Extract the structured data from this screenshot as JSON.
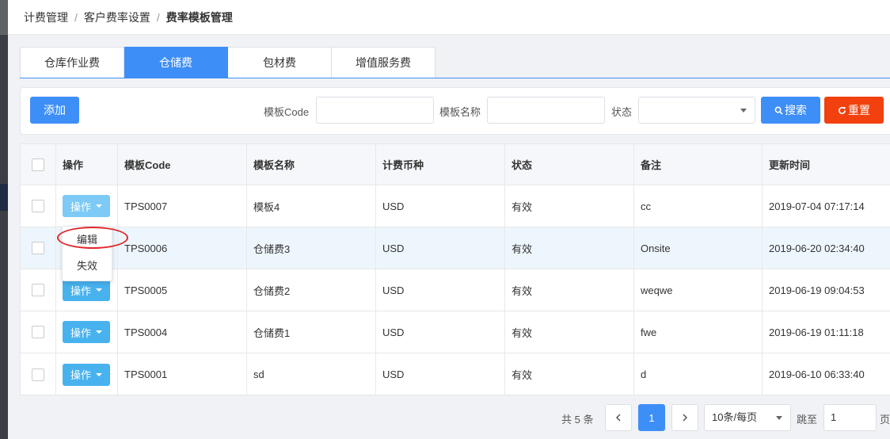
{
  "breadcrumb": {
    "item1": "计费管理",
    "item2": "客户费率设置",
    "current": "费率模板管理"
  },
  "tabs": [
    {
      "label": "仓库作业费",
      "active": false
    },
    {
      "label": "仓储费",
      "active": true
    },
    {
      "label": "包材费",
      "active": false
    },
    {
      "label": "增值服务费",
      "active": false
    }
  ],
  "filter": {
    "add_label": "添加",
    "code_label": "模板Code",
    "code_value": "",
    "name_label": "模板名称",
    "name_value": "",
    "status_label": "状态",
    "status_value": "",
    "search_label": "搜索",
    "reset_label": "重置"
  },
  "table": {
    "headers": [
      "操作",
      "模板Code",
      "模板名称",
      "计费币种",
      "状态",
      "备注",
      "更新时间"
    ],
    "op_label": "操作",
    "rows": [
      {
        "code": "TPS0007",
        "name": "模板4",
        "currency": "USD",
        "status": "有效",
        "remark": "cc",
        "updated": "2019-07-04 07:17:14"
      },
      {
        "code": "TPS0006",
        "name": "仓储费3",
        "currency": "USD",
        "status": "有效",
        "remark": "Onsite",
        "updated": "2019-06-20 02:34:40"
      },
      {
        "code": "TPS0005",
        "name": "仓储费2",
        "currency": "USD",
        "status": "有效",
        "remark": "weqwe",
        "updated": "2019-06-19 09:04:53"
      },
      {
        "code": "TPS0004",
        "name": "仓储费1",
        "currency": "USD",
        "status": "有效",
        "remark": "fwe",
        "updated": "2019-06-19 01:11:18"
      },
      {
        "code": "TPS0001",
        "name": "sd",
        "currency": "USD",
        "status": "有效",
        "remark": "d",
        "updated": "2019-06-10 06:33:40"
      }
    ]
  },
  "dropdown": {
    "edit_label": "编辑",
    "disable_label": "失效"
  },
  "pager": {
    "total": "共 5 条",
    "current_page": "1",
    "page_size": "10条/每页",
    "jump_label": "跳至",
    "jump_value": "1",
    "page_suffix": "页"
  },
  "colors": {
    "primary": "#3e8ef7",
    "reset": "#f2400e",
    "op_button": "#48b2ef",
    "highlight_ellipse": "#e3262a"
  }
}
